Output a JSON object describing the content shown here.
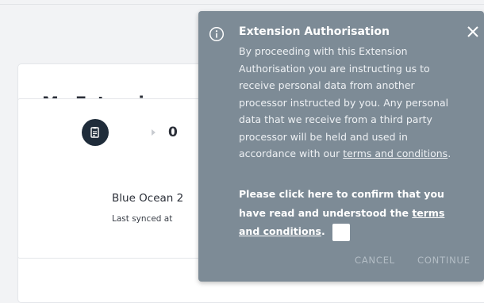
{
  "page": {
    "title": "My Extensions"
  },
  "extension": {
    "icon": "document-icon",
    "count": "0",
    "name": "Blue Ocean 2",
    "sync_text": "Last synced at"
  },
  "modal": {
    "title": "Extension Authorisation",
    "info_icon": "info-icon",
    "close_icon": "close-icon",
    "body_text": "By proceeding with this Extension Authorisation you are instructing us to receive personal data from another processor instructed by you. Any personal data that we receive from a third party processor will be held and used in accordance with our ",
    "body_link": "terms and conditions",
    "body_end": ".",
    "confirm_text": "Please click here to confirm that you have read and understood the ",
    "confirm_link": "terms and conditions",
    "confirm_end": ".",
    "checkbox_checked": false,
    "cancel_label": "CANCEL",
    "continue_label": "CONTINUE"
  },
  "colors": {
    "modal_bg": "#7d8b96",
    "button_disabled": "#b3bdc5",
    "icon_bg": "#1f2c3a"
  }
}
